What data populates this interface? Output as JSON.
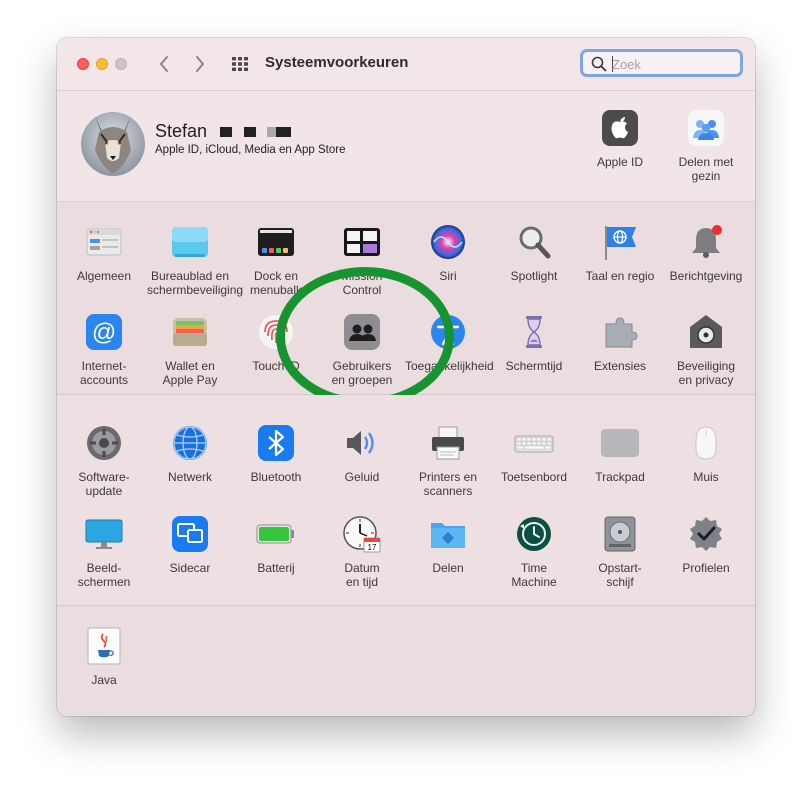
{
  "window": {
    "title": "Systeemvoorkeuren",
    "search": {
      "placeholder": "Zoek",
      "value": ""
    }
  },
  "account": {
    "name": "Stefan",
    "subtitle": "Apple ID, iCloud, Media en App Store",
    "items": [
      {
        "label": "Apple ID",
        "icon": "apple-logo-icon"
      },
      {
        "label": "Delen met\ngezin",
        "icon": "family-sharing-icon"
      }
    ]
  },
  "row1": [
    {
      "label": "Algemeen",
      "icon": "general-icon"
    },
    {
      "label": "Bureaublad en\nschermbeveiliging",
      "icon": "desktop-screensaver-icon"
    },
    {
      "label": "Dock en\nmenubalk",
      "icon": "dock-menubar-icon"
    },
    {
      "label": "Mission\nControl",
      "icon": "mission-control-icon"
    },
    {
      "label": "Siri",
      "icon": "siri-icon"
    },
    {
      "label": "Spotlight",
      "icon": "spotlight-icon"
    },
    {
      "label": "Taal en regio",
      "icon": "language-region-icon"
    },
    {
      "label": "Berichtgeving",
      "icon": "notifications-icon"
    }
  ],
  "row2": [
    {
      "label": "Internet-\naccounts",
      "icon": "internet-accounts-icon"
    },
    {
      "label": "Wallet en\nApple Pay",
      "icon": "wallet-icon"
    },
    {
      "label": "Touch ID",
      "icon": "touch-id-icon"
    },
    {
      "label": "Gebruikers\nen groepen",
      "icon": "users-groups-icon"
    },
    {
      "label": "Toegankelijkheid",
      "icon": "accessibility-icon"
    },
    {
      "label": "Schermtijd",
      "icon": "screen-time-icon"
    },
    {
      "label": "Extensies",
      "icon": "extensions-icon"
    },
    {
      "label": "Beveiliging\nen privacy",
      "icon": "security-privacy-icon"
    }
  ],
  "row3": [
    {
      "label": "Software-update",
      "icon": "software-update-icon"
    },
    {
      "label": "Netwerk",
      "icon": "network-icon"
    },
    {
      "label": "Bluetooth",
      "icon": "bluetooth-icon"
    },
    {
      "label": "Geluid",
      "icon": "sound-icon"
    },
    {
      "label": "Printers en\nscanners",
      "icon": "printers-scanners-icon"
    },
    {
      "label": "Toetsenbord",
      "icon": "keyboard-icon"
    },
    {
      "label": "Trackpad",
      "icon": "trackpad-icon"
    },
    {
      "label": "Muis",
      "icon": "mouse-icon"
    }
  ],
  "row4": [
    {
      "label": "Beeld-\nschermen",
      "icon": "displays-icon"
    },
    {
      "label": "Sidecar",
      "icon": "sidecar-icon"
    },
    {
      "label": "Batterij",
      "icon": "battery-icon"
    },
    {
      "label": "Datum\nen tijd",
      "icon": "date-time-icon"
    },
    {
      "label": "Delen",
      "icon": "sharing-icon"
    },
    {
      "label": "Time\nMachine",
      "icon": "time-machine-icon"
    },
    {
      "label": "Opstart-\nschijf",
      "icon": "startup-disk-icon"
    },
    {
      "label": "Profielen",
      "icon": "profiles-icon"
    }
  ],
  "row5": [
    {
      "label": "Java",
      "icon": "java-icon"
    }
  ],
  "calendar_day": "17"
}
